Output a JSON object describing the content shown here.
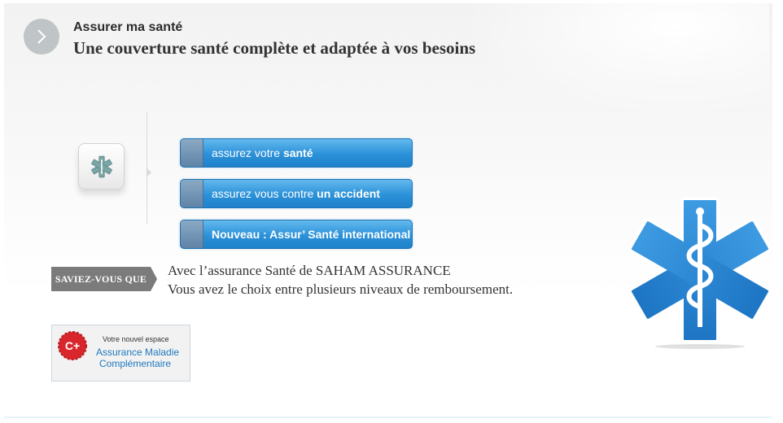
{
  "header": {
    "kicker": "Assurer ma santé",
    "title": "Une couverture santé complète et adaptée à vos besoins",
    "nav_icon": "chevron-right-icon"
  },
  "side_icon": "medical-star-icon",
  "buttons": [
    {
      "prefix": "assurez votre ",
      "strong": "santé"
    },
    {
      "prefix": "assurez vous contre ",
      "strong": "un accident"
    },
    {
      "label": "Nouveau : Assur’ Santé international"
    }
  ],
  "tip": {
    "badge": "SAVIEZ-VOUS QUE",
    "line1": "Avec l’assurance Santé de SAHAM ASSURANCE",
    "line2": "Vous avez le choix entre plusieurs niveaux de remboursement."
  },
  "promo": {
    "line1": "Votre nouvel espace",
    "line2": "Assurance Maladie",
    "line3": "Complémentaire",
    "badge_text": "C+"
  },
  "colors": {
    "accent": "#2b91d8",
    "star": "#2d8ad6",
    "badge_red": "#d8262c"
  }
}
